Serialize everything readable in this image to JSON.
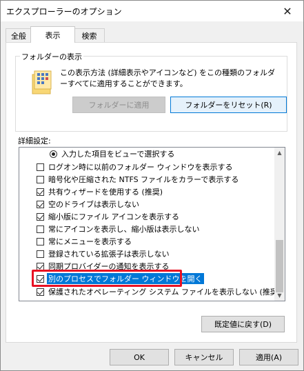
{
  "window": {
    "title": "エクスプローラーのオプション"
  },
  "tabs": [
    {
      "label": "全般"
    },
    {
      "label": "表示"
    },
    {
      "label": "検索"
    }
  ],
  "folder_view": {
    "group_label": "フォルダーの表示",
    "description": "この表示方法 (詳細表示やアイコンなど) をこの種類のフォルダーすべてに適用することができます。",
    "apply_button": "フォルダーに適用",
    "reset_button": "フォルダーをリセット(R)"
  },
  "advanced": {
    "label": "詳細設定:",
    "items": [
      {
        "type": "radio",
        "checked": true,
        "label": "入力した項目をビューで選択する"
      },
      {
        "type": "checkbox",
        "checked": false,
        "label": "ログオン時に以前のフォルダー ウィンドウを表示する"
      },
      {
        "type": "checkbox",
        "checked": false,
        "label": "暗号化や圧縮された NTFS ファイルをカラーで表示する"
      },
      {
        "type": "checkbox",
        "checked": true,
        "label": "共有ウィザードを使用する (推奨)"
      },
      {
        "type": "checkbox",
        "checked": true,
        "label": "空のドライブは表示しない"
      },
      {
        "type": "checkbox",
        "checked": true,
        "label": "縮小版にファイル アイコンを表示する"
      },
      {
        "type": "checkbox",
        "checked": false,
        "label": "常にアイコンを表示し、縮小版は表示しない"
      },
      {
        "type": "checkbox",
        "checked": false,
        "label": "常にメニューを表示する"
      },
      {
        "type": "checkbox",
        "checked": false,
        "label": "登録されている拡張子は表示しない"
      },
      {
        "type": "checkbox",
        "checked": true,
        "label": "同期プロバイダーの通知を表示する"
      },
      {
        "type": "checkbox",
        "checked": true,
        "label": "別のプロセスでフォルダー ウィンドウを開く",
        "selected": true
      },
      {
        "type": "checkbox",
        "checked": true,
        "label": "保護されたオペレーティング システム ファイルを表示しない (推奨)"
      }
    ],
    "restore_defaults_button": "既定値に戻す(D)"
  },
  "footer": {
    "ok": "OK",
    "cancel": "キャンセル",
    "apply": "適用(A)"
  },
  "colors": {
    "selection": "#0078d7",
    "highlight_border": "#e81123"
  }
}
